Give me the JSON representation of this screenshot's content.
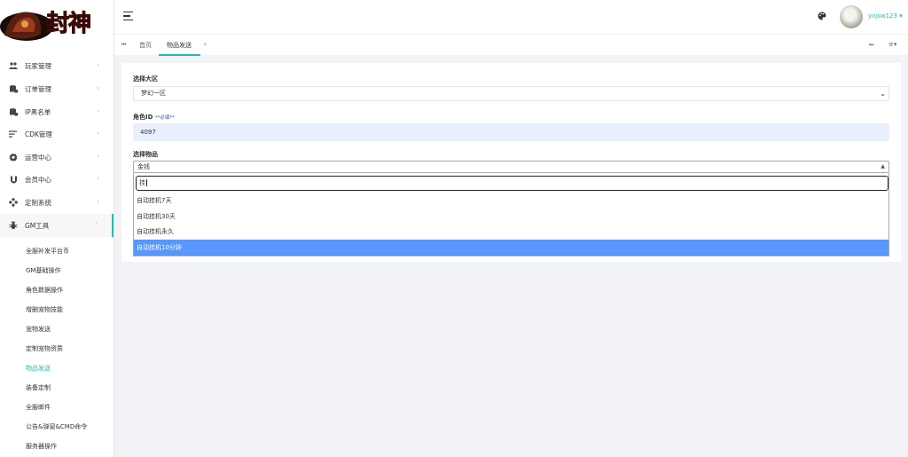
{
  "logo": {
    "text": "封神"
  },
  "sidebar": {
    "items": [
      {
        "label": "玩家管理",
        "icon": "users-icon"
      },
      {
        "label": "订单管理",
        "icon": "database-icon"
      },
      {
        "label": "IP黑名单",
        "icon": "database-icon"
      },
      {
        "label": "CDK管理",
        "icon": "list-icon"
      },
      {
        "label": "运营中心",
        "icon": "gear-icon"
      },
      {
        "label": "会员中心",
        "icon": "magnet-icon"
      },
      {
        "label": "定制系统",
        "icon": "apps-icon"
      },
      {
        "label": "GM工具",
        "icon": "bug-icon",
        "active": true
      }
    ],
    "subitems": [
      "全服补发平台币",
      "GM基础操作",
      "角色数据操作",
      "增删宠物技能",
      "宠物发送",
      "定制宠物资质",
      "物品发送",
      "装备定制",
      "全服邮件",
      "公告&弹窗&CMD命令",
      "服务器操作"
    ],
    "current_subitem": "物品发送"
  },
  "header": {
    "username": "yxjsw123"
  },
  "tabs": {
    "home": "首页",
    "current": "物品发送"
  },
  "form": {
    "region_label": "选择大区",
    "region_value": "梦幻一区",
    "role_label": "角色ID",
    "role_required": "**必填**",
    "role_value": "4097",
    "item_label": "选择物品",
    "item_value": "金钱",
    "search_value": "挂",
    "options": [
      "自动挂机7天",
      "自动挂机30天",
      "自动挂机永久",
      "自动挂机10分钟"
    ],
    "highlighted_option": "自动挂机10分钟"
  },
  "colors": {
    "accent": "#26b8b0",
    "highlight": "#5897fb",
    "input_bg": "#e8f0fe",
    "required": "#2553c9"
  }
}
